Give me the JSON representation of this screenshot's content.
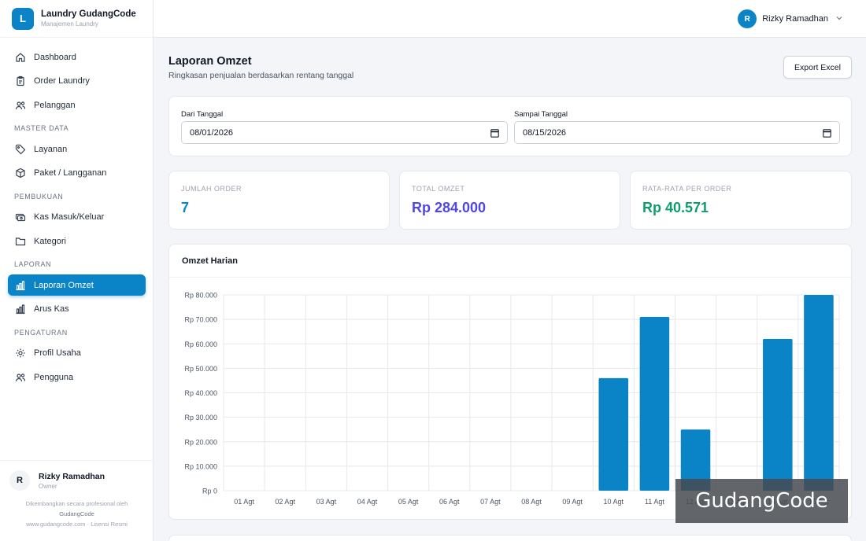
{
  "brand": {
    "logo_letter": "L",
    "name": "Laundry GudangCode",
    "subtitle": "Manajemen Laundry"
  },
  "nav": {
    "main": [
      {
        "label": "Dashboard",
        "icon": "home-icon"
      },
      {
        "label": "Order Laundry",
        "icon": "clipboard-icon"
      },
      {
        "label": "Pelanggan",
        "icon": "users-icon"
      }
    ],
    "master_label": "MASTER DATA",
    "master": [
      {
        "label": "Layanan",
        "icon": "tag-icon"
      },
      {
        "label": "Paket / Langganan",
        "icon": "package-icon"
      }
    ],
    "pembukuan_label": "PEMBUKUAN",
    "pembukuan": [
      {
        "label": "Kas Masuk/Keluar",
        "icon": "cash-icon"
      },
      {
        "label": "Kategori",
        "icon": "folder-icon"
      }
    ],
    "laporan_label": "LAPORAN",
    "laporan": [
      {
        "label": "Laporan Omzet",
        "icon": "bar-chart-icon",
        "active": true
      },
      {
        "label": "Arus Kas",
        "icon": "bar-chart-icon"
      }
    ],
    "pengaturan_label": "PENGATURAN",
    "pengaturan": [
      {
        "label": "Profil Usaha",
        "icon": "gear-icon"
      },
      {
        "label": "Pengguna",
        "icon": "users-icon"
      }
    ]
  },
  "sidebar_footer": {
    "avatar_letter": "R",
    "name": "Rizky Ramadhan",
    "role": "Owner",
    "credit_line1": "Dikembangkan secara profesional oleh",
    "credit_line2": "GudangCode",
    "credit_line3": "www.gudangcode.com · Lisensi Resmi"
  },
  "topbar": {
    "avatar_letter": "R",
    "user_name": "Rizky Ramadhan"
  },
  "page": {
    "title": "Laporan Omzet",
    "subtitle": "Ringkasan penjualan berdasarkan rentang tanggal",
    "export_label": "Export Excel"
  },
  "filter": {
    "from_label": "Dari Tanggal",
    "from_value": "08/01/2026",
    "to_label": "Sampai Tanggal",
    "to_value": "08/15/2026"
  },
  "stats": [
    {
      "label": "JUMLAH ORDER",
      "value": "7",
      "color": "#0a84c6"
    },
    {
      "label": "TOTAL OMZET",
      "value": "Rp 284.000",
      "color": "#4f46e5"
    },
    {
      "label": "RATA-RATA PER ORDER",
      "value": "Rp 40.571",
      "color": "#0f9d6b"
    }
  ],
  "chart_title": "Omzet Harian",
  "chart_data": {
    "type": "bar",
    "categories": [
      "01 Agt",
      "02 Agt",
      "03 Agt",
      "04 Agt",
      "05 Agt",
      "06 Agt",
      "07 Agt",
      "08 Agt",
      "09 Agt",
      "10 Agt",
      "11 Agt",
      "12 Agt",
      "13 Agt",
      "14 Agt",
      "15 Agt"
    ],
    "values": [
      0,
      0,
      0,
      0,
      0,
      0,
      0,
      0,
      0,
      46000,
      71000,
      25000,
      0,
      62000,
      80000
    ],
    "ylim": [
      0,
      80000
    ],
    "yticks": [
      "Rp 80.000",
      "Rp 70.000",
      "Rp 60.000",
      "Rp 50.000",
      "Rp 40.000",
      "Rp 30.000",
      "Rp 20.000",
      "Rp 10.000",
      "Rp 0"
    ],
    "bar_color": "#0a84c6",
    "grid": true
  },
  "watermark": "GudangCode"
}
